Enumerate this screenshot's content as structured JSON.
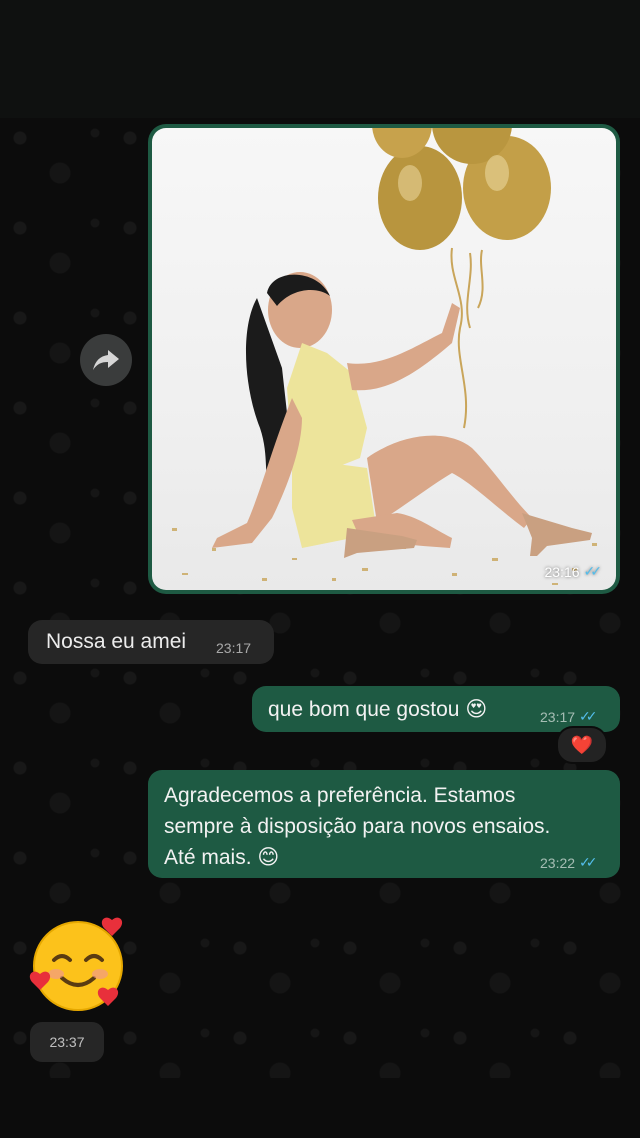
{
  "messages": {
    "image": {
      "time": "23:16",
      "status": "read"
    },
    "incoming_1": {
      "text": "Nossa eu amei",
      "time": "23:17"
    },
    "outgoing_1": {
      "text": "que bom que gostou 😍",
      "time": "23:17",
      "status": "read",
      "reaction": "❤️"
    },
    "outgoing_2": {
      "line1": "Agradecemos a preferência. Estamos",
      "line2": "sempre à disposição para novos ensaios.",
      "line3": "Até mais. 😊",
      "time": "23:22",
      "status": "read"
    },
    "sticker": {
      "emoji": "🥰",
      "time": "23:37"
    }
  },
  "icons": {
    "forward": "forward-arrow-icon",
    "read_receipt": "double-check-icon"
  },
  "colors": {
    "outgoing_bubble": "#1e5a43",
    "incoming_bubble": "#262626",
    "read_check": "#53bdeb",
    "background": "#0c0c0c"
  }
}
